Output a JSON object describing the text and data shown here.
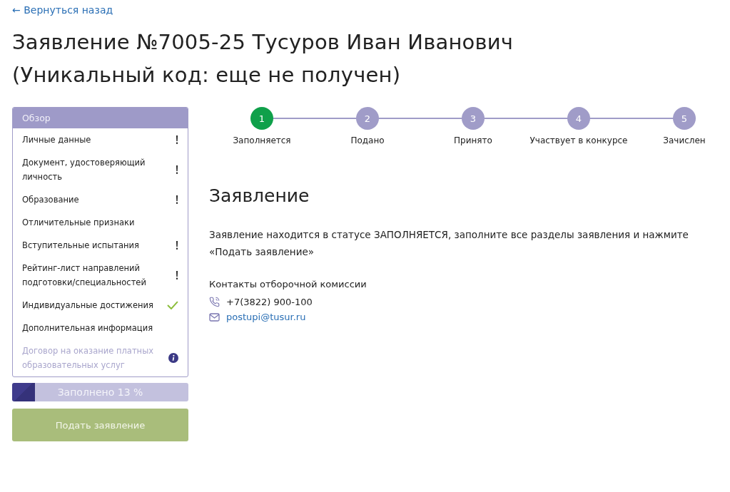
{
  "back_link": "← Вернуться назад",
  "title": "Заявление №7005-25 Тусуров Иван Иванович (Уникальный код: еще не получен)",
  "sidebar": {
    "header": "Обзор",
    "items": [
      {
        "label": "Личные данные",
        "kind": "warning",
        "disabled": false
      },
      {
        "label": "Документ, удостоверяющий личность",
        "kind": "warning",
        "disabled": false
      },
      {
        "label": "Образование",
        "kind": "warning",
        "disabled": false
      },
      {
        "label": "Отличительные признаки",
        "kind": "plain",
        "disabled": false
      },
      {
        "label": "Вступительные испытания",
        "kind": "warning",
        "disabled": false
      },
      {
        "label": "Рейтинг-лист направлений подготовки/специальностей",
        "kind": "warning",
        "disabled": false
      },
      {
        "label": "Индивидуальные достижения",
        "kind": "done",
        "disabled": false
      },
      {
        "label": "Дополнительная информация",
        "kind": "plain",
        "disabled": false
      },
      {
        "label": "Договор на оказание платных образовательных услуг",
        "kind": "info",
        "disabled": true
      }
    ]
  },
  "progress": {
    "label": "Заполнено 13 %",
    "level": 0.13
  },
  "submit_button": {
    "label": "Подать заявление",
    "disabled": true
  },
  "steps": [
    {
      "number": "1",
      "label": "Заполняется",
      "selected": true
    },
    {
      "number": "2",
      "label": "Подано",
      "selected": false
    },
    {
      "number": "3",
      "label": "Принято",
      "selected": false
    },
    {
      "number": "4",
      "label": "Участвует в конкурсе",
      "selected": false
    },
    {
      "number": "5",
      "label": "Зачислен",
      "selected": false
    }
  ],
  "section": {
    "heading": "Заявление",
    "text": "Заявление находится в статусе ЗАПОЛНЯЕТСЯ, заполните все разделы заявления и нажмите «Подать заявление»",
    "contacts_heading": "Контакты отборочной комиссии",
    "phone": "+7(3822) 900-100",
    "email": "postupi@tusur.ru"
  }
}
